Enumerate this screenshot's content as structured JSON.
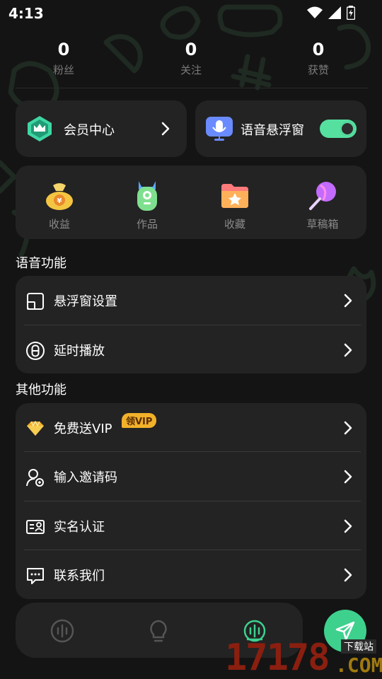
{
  "status_bar": {
    "time": "4:13"
  },
  "stats": [
    {
      "value": "0",
      "label": "粉丝"
    },
    {
      "value": "0",
      "label": "关注"
    },
    {
      "value": "0",
      "label": "获赞"
    }
  ],
  "vip_card": {
    "label": "会员中心"
  },
  "voice_card": {
    "label": "语音悬浮窗",
    "toggle_on": true
  },
  "grid": [
    {
      "label": "收益",
      "icon": "money-bag-icon"
    },
    {
      "label": "作品",
      "icon": "bottle-icon"
    },
    {
      "label": "收藏",
      "icon": "star-folder-icon"
    },
    {
      "label": "草稿箱",
      "icon": "lollipop-icon"
    }
  ],
  "voice_section": {
    "title": "语音功能",
    "items": [
      {
        "label": "悬浮窗设置",
        "icon": "floating-window-icon"
      },
      {
        "label": "延时播放",
        "icon": "timer-8-icon"
      }
    ]
  },
  "other_section": {
    "title": "其他功能",
    "items": [
      {
        "label": "免费送VIP",
        "icon": "gem-icon",
        "badge": "领VIP"
      },
      {
        "label": "输入邀请码",
        "icon": "user-add-icon"
      },
      {
        "label": "实名认证",
        "icon": "id-card-icon"
      },
      {
        "label": "联系我们",
        "icon": "chat-icon"
      }
    ]
  },
  "watermark": {
    "number": "17178",
    "site": "下载站",
    "domain": ".COM"
  },
  "colors": {
    "accent": "#3ed18e",
    "card": "#232323",
    "background": "#141414",
    "badge": "#f2b12a"
  }
}
